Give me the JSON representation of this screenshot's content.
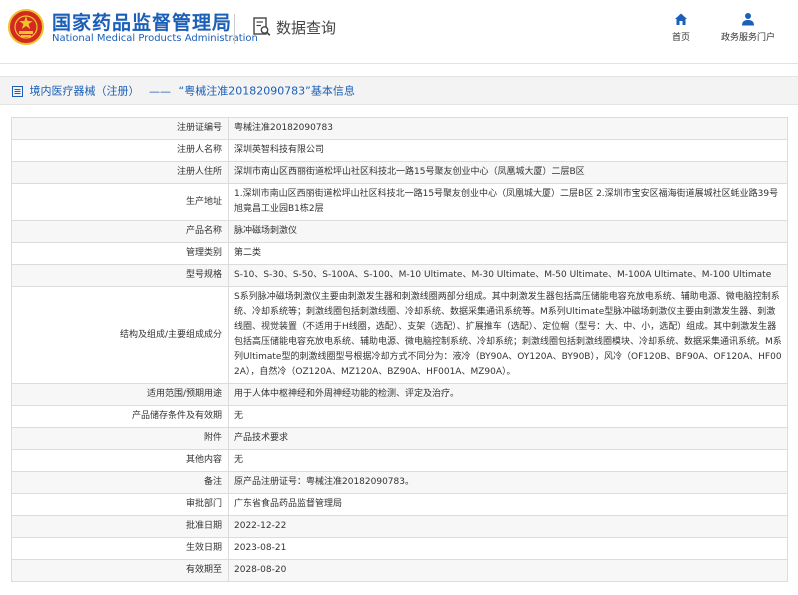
{
  "header": {
    "brand_cn": "国家药品监督管理局",
    "brand_en": "National Medical Products Administration",
    "section_title": "数据查询",
    "nav": [
      {
        "label": "首页",
        "icon": "home-icon"
      },
      {
        "label": "政务服务门户",
        "icon": "user-icon"
      }
    ]
  },
  "breadcrumb": {
    "category": "境内医疗器械（注册）",
    "separator": "——",
    "record": "“粤械注准20182090783”基本信息"
  },
  "colors": {
    "brand_blue": "#1b5fb8",
    "emblem_red": "#d22a1f",
    "emblem_gold": "#f2c12e"
  },
  "fields": [
    {
      "label": "注册证编号",
      "value": "粤械注准20182090783"
    },
    {
      "label": "注册人名称",
      "value": "深圳英智科技有限公司"
    },
    {
      "label": "注册人住所",
      "value": "深圳市南山区西丽街道松坪山社区科技北一路15号聚友创业中心（凤凰城大厦）二层B区"
    },
    {
      "label": "生产地址",
      "value": "1.深圳市南山区西丽街道松坪山社区科技北一路15号聚友创业中心（凤凰城大厦）二层B区 2.深圳市宝安区福海街道展城社区蚝业路39号旭竟昌工业园B1栋2层"
    },
    {
      "label": "产品名称",
      "value": "脉冲磁场刺激仪"
    },
    {
      "label": "管理类别",
      "value": "第二类"
    },
    {
      "label": "型号规格",
      "value": "S-10、S-30、S-50、S-100A、S-100、M-10 Ultimate、M-30 Ultimate、M-50 Ultimate、M-100A Ultimate、M-100 Ultimate"
    },
    {
      "label": "结构及组成/主要组成成分",
      "value": "S系列脉冲磁场刺激仪主要由刺激发生器和刺激线圈两部分组成。其中刺激发生器包括高压储能电容充放电系统、辅助电源、微电脑控制系统、冷却系统等；刺激线圈包括刺激线圈、冷却系统、数据采集通讯系统等。M系列Ultimate型脉冲磁场刺激仪主要由刺激发生器、刺激线圈、视觉装置（不适用于H线圈，选配）、支架（选配）、扩展推车（选配）、定位帽（型号：大、中、小，选配）组成。其中刺激发生器包括高压储能电容充放电系统、辅助电源、微电脑控制系统、冷却系统；刺激线圈包括刺激线圈模块、冷却系统、数据采集通讯系统。M系列Ultimate型的刺激线圈型号根据冷却方式不同分为：液冷（BY90A、OY120A、BY90B），风冷（OF120B、BF90A、OF120A、HF002A），自然冷（OZ120A、MZ120A、BZ90A、HF001A、MZ90A）。"
    },
    {
      "label": "适用范围/预期用途",
      "value": "用于人体中枢神经和外周神经功能的检测、评定及治疗。"
    },
    {
      "label": "产品储存条件及有效期",
      "value": "无"
    },
    {
      "label": "附件",
      "value": "产品技术要求"
    },
    {
      "label": "其他内容",
      "value": "无"
    },
    {
      "label": "备注",
      "value": "原产品注册证号：粤械注准20182090783。"
    },
    {
      "label": "审批部门",
      "value": "广东省食品药品监督管理局"
    },
    {
      "label": "批准日期",
      "value": "2022-12-22"
    },
    {
      "label": "生效日期",
      "value": "2023-08-21"
    },
    {
      "label": "有效期至",
      "value": "2028-08-20"
    }
  ]
}
